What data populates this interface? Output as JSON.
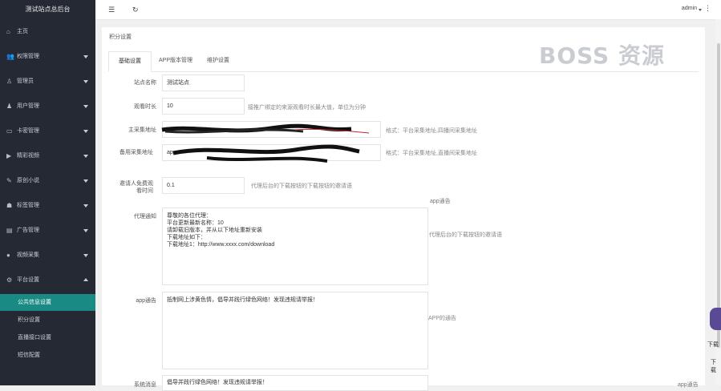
{
  "sidebar": {
    "brand": "测试站点总后台",
    "items": [
      {
        "label": "主页",
        "icon": "home-icon",
        "glyph": "⌂"
      },
      {
        "label": "权限管理",
        "icon": "users-icon",
        "glyph": "👥"
      },
      {
        "label": "管理员",
        "icon": "user-icon",
        "glyph": "♙"
      },
      {
        "label": "用户管理",
        "icon": "user-manage-icon",
        "glyph": "♟"
      },
      {
        "label": "卡密管理",
        "icon": "card-icon",
        "glyph": "▭"
      },
      {
        "label": "精彩视频",
        "icon": "video-icon",
        "glyph": "▶"
      },
      {
        "label": "原创小说",
        "icon": "book-icon",
        "glyph": "✎"
      },
      {
        "label": "标签管理",
        "icon": "tag-icon",
        "glyph": "☗"
      },
      {
        "label": "广告管理",
        "icon": "ad-icon",
        "glyph": "▤"
      },
      {
        "label": "视频采集",
        "icon": "collect-icon",
        "glyph": "●"
      },
      {
        "label": "平台设置",
        "icon": "settings-icon",
        "glyph": "⚙"
      }
    ],
    "sub_items": [
      {
        "label": "公共信息设置"
      },
      {
        "label": "积分设置"
      },
      {
        "label": "直播接口设置"
      },
      {
        "label": "短信配置"
      }
    ]
  },
  "topbar": {
    "menu_glyph": "☰",
    "refresh_glyph": "↻",
    "user": "admin",
    "more_glyph": "⋮"
  },
  "panel": {
    "title": "积分设置",
    "tabs": [
      {
        "label": "基础设置"
      },
      {
        "label": "APP版本管理"
      },
      {
        "label": "维护设置"
      }
    ]
  },
  "form": {
    "site_name_label": "站点名称",
    "site_name_value": "测试站点",
    "watch_time_label": "观看时长",
    "watch_time_value": "10",
    "watch_time_help": "接推广绑定的来源观看时长最大值，单位为分钟",
    "main_url_label": "主采集地址",
    "main_url_help": "格式：平台采集地址,四播间采集地址",
    "backup_url_label": "备用采集地址",
    "backup_url_value": "ap",
    "backup_url_help": "格式：平台采集地址,直播间采集地址",
    "invite_label": "邀请人免费观看时间",
    "invite_value": "0.1",
    "invite_help": "代理后台的下载按钮的下载按钮的邀请语",
    "app_tip_right": "app通告",
    "agent_notice_label": "代理通知",
    "agent_notice_lines": [
      "尊敬的各位代理：",
      "",
      "平台更新最新名称：10",
      "请卸载旧版本，并从以下地址重新安装",
      "",
      "下载地址如下：",
      "",
      "下载地址1：http://www.xxxx.com/download"
    ],
    "agent_notice_help": "代理后台的下载按钮的邀请语",
    "app_notice_label": "app通告",
    "app_notice_value": "抵制网上涉黄色情，倡导并践行绿色网络！发现违规请举报！",
    "app_notice_help": "APP的通告",
    "system_msg_label": "系统消息",
    "system_msg_value": "倡导并践行绿色网络！发现违规请举报！",
    "bottom_right": "app通告"
  },
  "watermark": "BOSS 资源",
  "float": {
    "label1": "下载",
    "label2": "下载"
  }
}
